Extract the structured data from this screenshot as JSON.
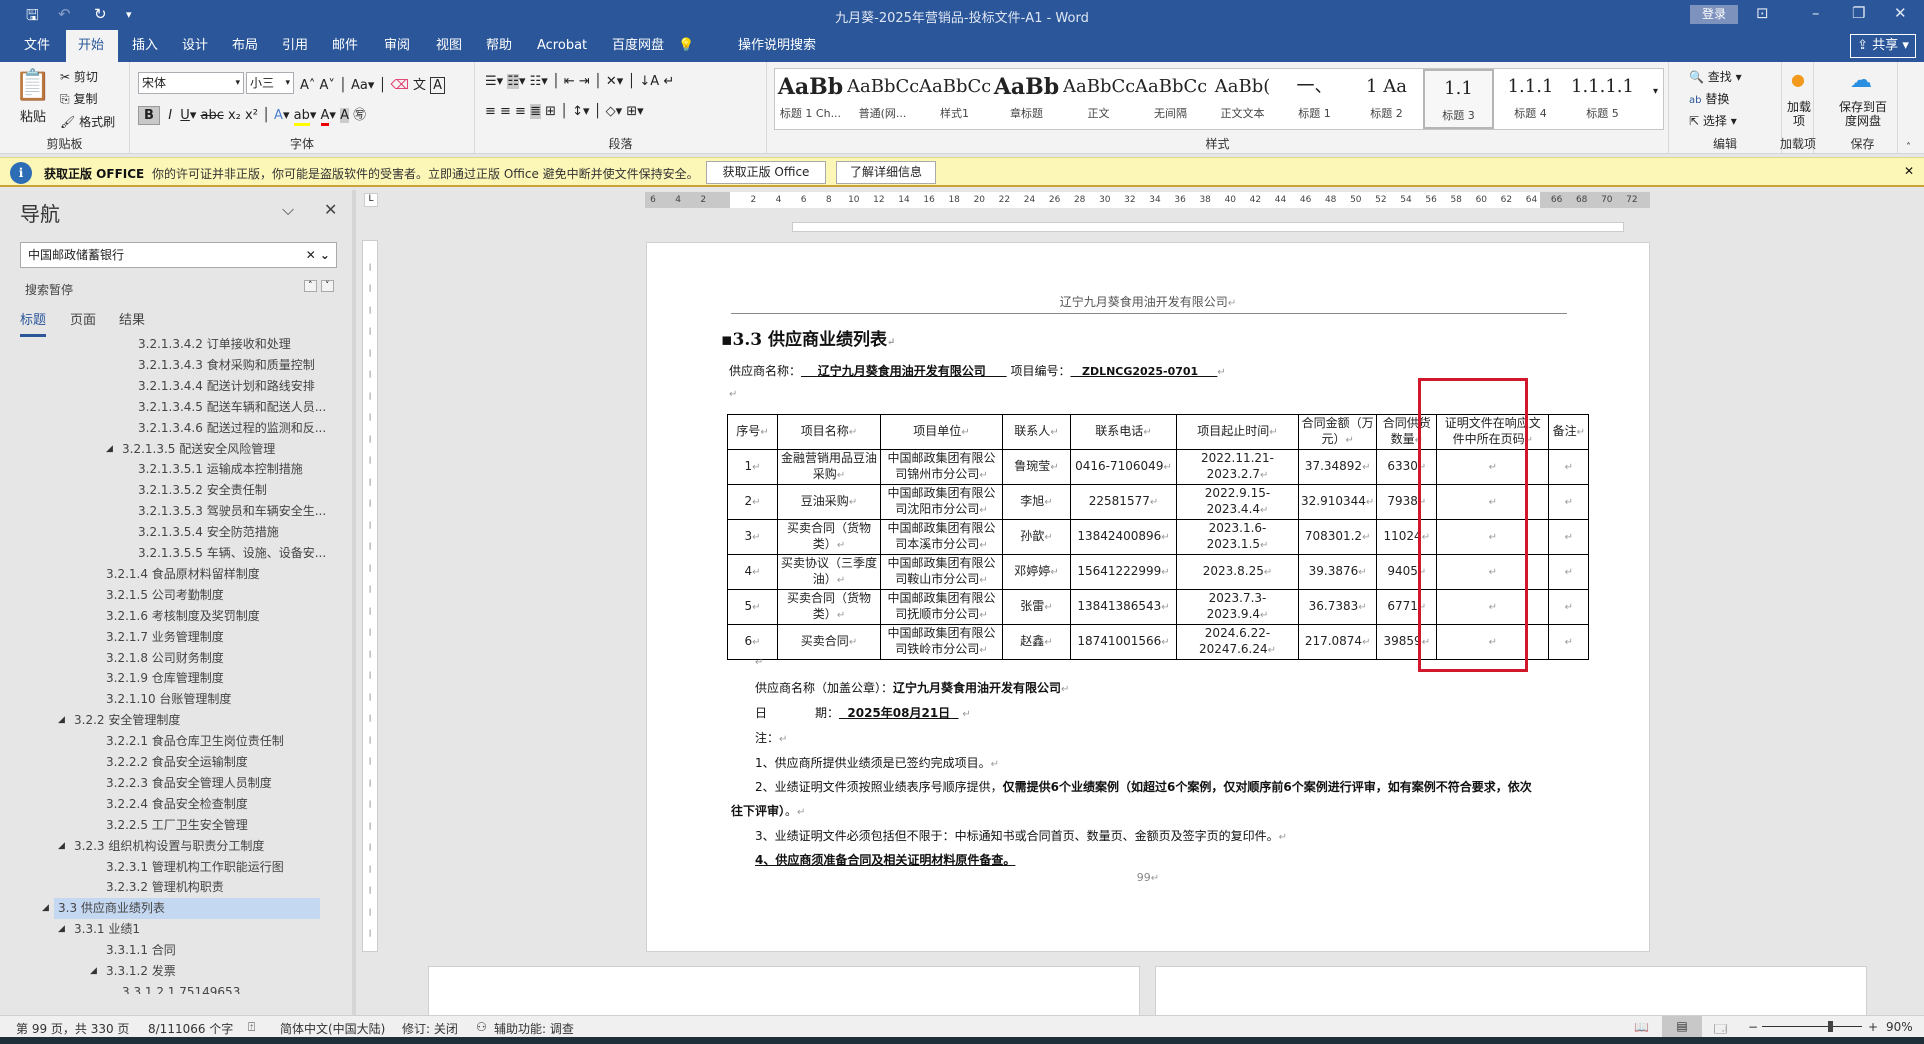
{
  "window": {
    "title": "九月葵-2025年营销品-投标文件-A1  -  Word",
    "login": "登录",
    "share": "共享"
  },
  "colors": {
    "titlebar": "#2b579a",
    "highlight_box": "#d0182a",
    "message_bar": "#fcf7b6"
  },
  "tabs": [
    "文件",
    "开始",
    "插入",
    "设计",
    "布局",
    "引用",
    "邮件",
    "审阅",
    "视图",
    "帮助",
    "Acrobat",
    "百度网盘",
    "操作说明搜索"
  ],
  "active_tab": "开始",
  "ribbon": {
    "clipboard": {
      "paste": "粘贴",
      "cut": "剪切",
      "copy": "复制",
      "format_painter": "格式刷",
      "label": "剪贴板"
    },
    "font": {
      "font_name": "宋体",
      "font_size": "小三",
      "label": "字体"
    },
    "paragraph": {
      "label": "段落"
    },
    "styles": {
      "label": "样式",
      "items": [
        {
          "preview": "AaBb",
          "name": "标题 1 Ch..."
        },
        {
          "preview": "AaBbCcDc",
          "name": "普通(网..."
        },
        {
          "preview": "AaBbCc",
          "name": "样式1"
        },
        {
          "preview": "AaBb",
          "name": "章标题"
        },
        {
          "preview": "AaBbCcDdI",
          "name": "正文"
        },
        {
          "preview": "AaBbCcDdI",
          "name": "无间隔"
        },
        {
          "preview": "AaBb(",
          "name": "正文文本"
        },
        {
          "preview": "一、",
          "name": "标题 1"
        },
        {
          "preview": "1  Aa",
          "name": "标题 2"
        },
        {
          "preview": "1.1",
          "name": "标题 3"
        },
        {
          "preview": "1.1.1",
          "name": "标题 4"
        },
        {
          "preview": "1.1.1.1",
          "name": "标题 5"
        }
      ],
      "selected": "标题 3"
    },
    "editing": {
      "find": "查找",
      "replace": "替换",
      "select": "选择",
      "label": "编辑"
    },
    "addins": {
      "button": "加载项",
      "label": "加载项"
    },
    "save": {
      "button": "保存到百度网盘",
      "label": "保存"
    }
  },
  "message_bar": {
    "title": "获取正版 OFFICE",
    "text": "你的许可证并非正版，你可能是盗版软件的受害者。立即通过正版 Office 避免中断并使文件保持安全。",
    "btn1": "获取正版 Office",
    "btn2": "了解详细信息"
  },
  "nav": {
    "title": "导航",
    "search_value": "中国邮政储蓄银行",
    "status": "搜索暂停",
    "tabs": [
      "标题",
      "页面",
      "结果"
    ],
    "items": [
      {
        "t": "3.2.1.3.4.2 订单接收和处理",
        "lvl": 4
      },
      {
        "t": "3.2.1.3.4.3 食材采购和质量控制",
        "lvl": 4
      },
      {
        "t": "3.2.1.3.4.4 配送计划和路线安排",
        "lvl": 4
      },
      {
        "t": "3.2.1.3.4.5 配送车辆和配送人员...",
        "lvl": 4
      },
      {
        "t": "3.2.1.3.4.6 配送过程的监测和反...",
        "lvl": 4
      },
      {
        "t": "3.2.1.3.5 配送安全风险管理",
        "lvl": 3,
        "exp": true
      },
      {
        "t": "3.2.1.3.5.1 运输成本控制措施",
        "lvl": 4
      },
      {
        "t": "3.2.1.3.5.2 安全责任制",
        "lvl": 4
      },
      {
        "t": "3.2.1.3.5.3 驾驶员和车辆安全生...",
        "lvl": 4
      },
      {
        "t": "3.2.1.3.5.4 安全防范措施",
        "lvl": 4
      },
      {
        "t": "3.2.1.3.5.5 车辆、设施、设备安...",
        "lvl": 4
      },
      {
        "t": "3.2.1.4 食品原材料留样制度",
        "lvl": 2
      },
      {
        "t": "3.2.1.5 公司考勤制度",
        "lvl": 2
      },
      {
        "t": "3.2.1.6 考核制度及奖罚制度",
        "lvl": 2
      },
      {
        "t": "3.2.1.7 业务管理制度",
        "lvl": 2
      },
      {
        "t": "3.2.1.8 公司财务制度",
        "lvl": 2
      },
      {
        "t": "3.2.1.9 仓库管理制度",
        "lvl": 2
      },
      {
        "t": "3.2.1.10 台账管理制度",
        "lvl": 2
      },
      {
        "t": "3.2.2 安全管理制度",
        "lvl": 1,
        "exp": true
      },
      {
        "t": "3.2.2.1 食品仓库卫生岗位责任制",
        "lvl": 2
      },
      {
        "t": "3.2.2.2 食品安全运输制度",
        "lvl": 2
      },
      {
        "t": "3.2.2.3 食品安全管理人员制度",
        "lvl": 2
      },
      {
        "t": "3.2.2.4 食品安全检查制度",
        "lvl": 2
      },
      {
        "t": "3.2.2.5 工厂卫生安全管理",
        "lvl": 2
      },
      {
        "t": "3.2.3 组织机构设置与职责分工制度",
        "lvl": 1,
        "exp": true
      },
      {
        "t": "3.2.3.1 管理机构工作职能运行图",
        "lvl": 2
      },
      {
        "t": "3.2.3.2 管理机构职责",
        "lvl": 2
      },
      {
        "t": "3.3 供应商业绩列表",
        "lvl": 0,
        "exp": true,
        "sel": true
      },
      {
        "t": "3.3.1 业绩1",
        "lvl": 1,
        "exp": true
      },
      {
        "t": "3.3.1.1 合同",
        "lvl": 2
      },
      {
        "t": "3.3.1.2 发票",
        "lvl": 2,
        "exp": true
      },
      {
        "t": "3.3.1.2.1 75149653",
        "lvl": 3
      }
    ]
  },
  "ruler": [
    "6",
    "4",
    "2",
    "",
    "2",
    "4",
    "6",
    "8",
    "10",
    "12",
    "14",
    "16",
    "18",
    "20",
    "22",
    "24",
    "26",
    "28",
    "30",
    "32",
    "34",
    "36",
    "38",
    "40",
    "42",
    "44",
    "46",
    "48",
    "50",
    "52",
    "54",
    "56",
    "58",
    "60",
    "62",
    "64",
    "66",
    "68",
    "70",
    "72"
  ],
  "document": {
    "header": "辽宁九月葵食用油开发有限公司",
    "heading": "3.3 供应商业绩列表",
    "supplier_label": "供应商名称：",
    "supplier_name": "辽宁九月葵食用油开发有限公司",
    "project_no_label": "项目编号：",
    "project_no": "ZDLNCG2025-0701",
    "table": {
      "headers": [
        "序号",
        "项目名称",
        "项目单位",
        "联系人",
        "联系电话",
        "项目起止时间",
        "合同金额（万元）",
        "合同供货数量",
        "证明文件在响应文件中所在页码",
        "备注"
      ],
      "rows": [
        [
          "1",
          "金融营销用品豆油采购",
          "中国邮政集团有限公司锦州市分公司",
          "鲁琬莹",
          "0416-7106049",
          "2022.11.21-2023.2.7",
          "37.34892",
          "6330",
          "",
          ""
        ],
        [
          "2",
          "豆油采购",
          "中国邮政集团有限公司沈阳市分公司",
          "李旭",
          "22581577",
          "2022.9.15-2023.4.4",
          "32.910344",
          "7938",
          "",
          ""
        ],
        [
          "3",
          "买卖合同（货物类）",
          "中国邮政集团有限公司本溪市分公司",
          "孙歆",
          "13842400896",
          "2023.1.6-2023.1.5",
          "708301.2",
          "11024",
          "",
          ""
        ],
        [
          "4",
          "买卖协议（三季度油）",
          "中国邮政集团有限公司鞍山市分公司",
          "邓婷婷",
          "15641222999",
          "2023.8.25",
          "39.3876",
          "9405",
          "",
          ""
        ],
        [
          "5",
          "买卖合同（货物类）",
          "中国邮政集团有限公司抚顺市分公司",
          "张雷",
          "13841386543",
          "2023.7.3-2023.9.4",
          "36.7383",
          "6771",
          "",
          ""
        ],
        [
          "6",
          "买卖合同",
          "中国邮政集团有限公司铁岭市分公司",
          "赵鑫",
          "18741001566",
          "2024.6.22-20247.6.24",
          "217.0874",
          "39859",
          "",
          ""
        ]
      ]
    },
    "seal_label": "供应商名称（加盖公章）：",
    "seal_name": "辽宁九月葵食用油开发有限公司",
    "date_label": "日　　　　期：",
    "date": "2025年08月21日",
    "notes_label": "注：",
    "note1": "1、供应商所提供业绩须是已签约完成项目。",
    "note2a": "2、业绩证明文件须按照业绩表序号顺序提供，",
    "note2b": "仅需提供6个业绩案例（如超过6个案例，仅对顺序前6个案例进行评审，如有案例不符合要求，依次",
    "note2c": "往下评审）",
    "note2d": "。",
    "note3a": "3、业绩证明文件必须包括但不限于：",
    "note3b": "中标通知书或合同首页、数量页、金额页及签字页的复印件。",
    "note4": "4、供应商须准备合同及相关证明材料原件备查。",
    "page_number": "99"
  },
  "status": {
    "page": "第 99 页，共 330 页",
    "words": "8/111066 个字",
    "language": "简体中文(中国大陆)",
    "track": "修订: 关闭",
    "accessibility": "辅助功能: 调查",
    "zoom": "90%",
    "zoom_value": 90
  }
}
